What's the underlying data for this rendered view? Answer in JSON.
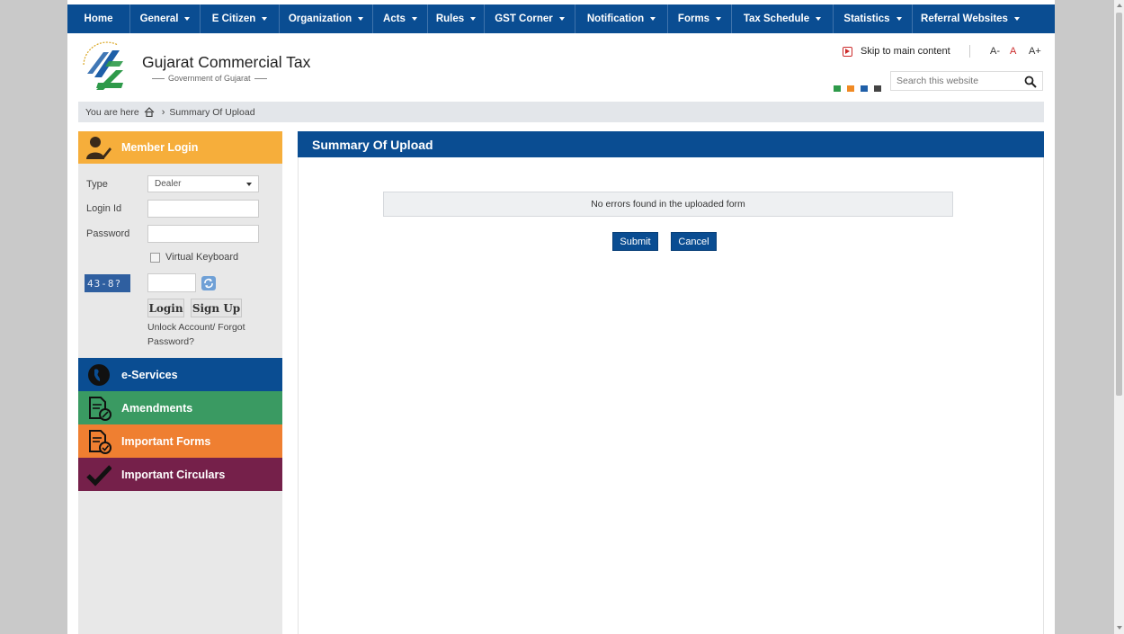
{
  "nav": {
    "items": [
      {
        "label": "Home",
        "dropdown": false
      },
      {
        "label": "General",
        "dropdown": true
      },
      {
        "label": "E Citizen",
        "dropdown": true
      },
      {
        "label": "Organization",
        "dropdown": true
      },
      {
        "label": "Acts",
        "dropdown": true
      },
      {
        "label": "Rules",
        "dropdown": true
      },
      {
        "label": "GST Corner",
        "dropdown": true
      },
      {
        "label": "Notification",
        "dropdown": true
      },
      {
        "label": "Forms",
        "dropdown": true
      },
      {
        "label": "Tax Schedule",
        "dropdown": true
      },
      {
        "label": "Statistics",
        "dropdown": true
      },
      {
        "label": "Referral Websites",
        "dropdown": true
      }
    ]
  },
  "header": {
    "title": "Gujarat Commercial Tax",
    "subtitle": "Government of Gujarat",
    "skip_label": "Skip to main content",
    "font_small": "A-",
    "font_normal": "A",
    "font_large": "A+",
    "search_placeholder": "Search this website",
    "swatch_colors": [
      "#2e9a4a",
      "#f08a24",
      "#1f5fa8",
      "#444444"
    ]
  },
  "breadcrumb": {
    "prefix": "You are here",
    "current": "Summary Of Upload"
  },
  "login": {
    "title": "Member Login",
    "type_label": "Type",
    "type_value": "Dealer",
    "login_id_label": "Login Id",
    "password_label": "Password",
    "virtual_keyboard_label": "Virtual Keyboard",
    "captcha_text": "43-8?",
    "login_button": "Login",
    "signup_button": "Sign Up",
    "unlock_text": "Unlock Account/ Forgot Password?"
  },
  "menus": [
    {
      "label": "e-Services",
      "color": "#0a4d92",
      "icon": "globe-icon"
    },
    {
      "label": "Amendments",
      "color": "#3a9a62",
      "icon": "document-edit-icon"
    },
    {
      "label": "Important Forms",
      "color": "#ef7f31",
      "icon": "form-check-icon"
    },
    {
      "label": "Important Circulars",
      "color": "#75204a",
      "icon": "checkmark-icon"
    }
  ],
  "content": {
    "title": "Summary Of Upload",
    "message": "No errors found in the uploaded form",
    "submit_label": "Submit",
    "cancel_label": "Cancel"
  }
}
